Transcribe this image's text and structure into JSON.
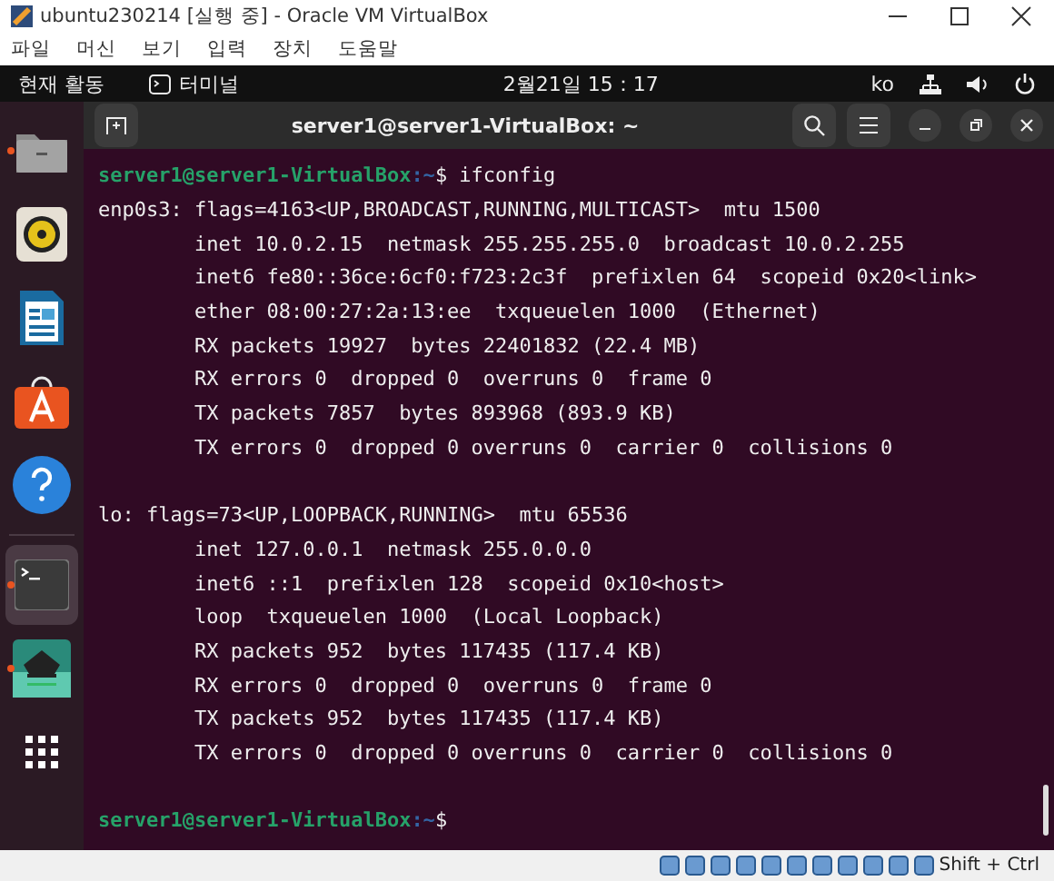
{
  "host_window": {
    "title": "ubuntu230214 [실행 중] - Oracle VM VirtualBox",
    "menu": [
      "파일",
      "머신",
      "보기",
      "입력",
      "장치",
      "도움말"
    ]
  },
  "top_bar": {
    "activities": "현재 활동",
    "app": "터미널",
    "clock": "2월21일  15：17",
    "input_method": "ko"
  },
  "dock": [
    {
      "kind": "files",
      "running": true,
      "selected": false
    },
    {
      "kind": "music",
      "running": false,
      "selected": false
    },
    {
      "kind": "writer",
      "running": false,
      "selected": false
    },
    {
      "kind": "store",
      "running": false,
      "selected": false
    },
    {
      "kind": "help",
      "running": false,
      "selected": false
    },
    {
      "kind": "terminal",
      "running": true,
      "selected": true
    },
    {
      "kind": "app",
      "running": true,
      "selected": false
    },
    {
      "kind": "grid",
      "running": false,
      "selected": false
    }
  ],
  "terminal": {
    "title": "server1@server1-VirtualBox: ~",
    "lines": [
      {
        "kind": "prompt",
        "user": "server1@server1-VirtualBox",
        "path": ":~",
        "sign": "$",
        "command": " ifconfig"
      },
      {
        "kind": "output",
        "text": "enp0s3: flags=4163<UP,BROADCAST,RUNNING,MULTICAST>  mtu 1500"
      },
      {
        "kind": "output",
        "text": "        inet 10.0.2.15  netmask 255.255.255.0  broadcast 10.0.2.255"
      },
      {
        "kind": "output",
        "text": "        inet6 fe80::36ce:6cf0:f723:2c3f  prefixlen 64  scopeid 0x20<link>"
      },
      {
        "kind": "output",
        "text": "        ether 08:00:27:2a:13:ee  txqueuelen 1000  (Ethernet)"
      },
      {
        "kind": "output",
        "text": "        RX packets 19927  bytes 22401832 (22.4 MB)"
      },
      {
        "kind": "output",
        "text": "        RX errors 0  dropped 0  overruns 0  frame 0"
      },
      {
        "kind": "output",
        "text": "        TX packets 7857  bytes 893968 (893.9 KB)"
      },
      {
        "kind": "output",
        "text": "        TX errors 0  dropped 0 overruns 0  carrier 0  collisions 0"
      },
      {
        "kind": "blank"
      },
      {
        "kind": "output",
        "text": "lo: flags=73<UP,LOOPBACK,RUNNING>  mtu 65536"
      },
      {
        "kind": "output",
        "text": "        inet 127.0.0.1  netmask 255.0.0.0"
      },
      {
        "kind": "output",
        "text": "        inet6 ::1  prefixlen 128  scopeid 0x10<host>"
      },
      {
        "kind": "output",
        "text": "        loop  txqueuelen 1000  (Local Loopback)"
      },
      {
        "kind": "output",
        "text": "        RX packets 952  bytes 117435 (117.4 KB)"
      },
      {
        "kind": "output",
        "text": "        RX errors 0  dropped 0  overruns 0  frame 0"
      },
      {
        "kind": "output",
        "text": "        TX packets 952  bytes 117435 (117.4 KB)"
      },
      {
        "kind": "output",
        "text": "        TX errors 0  dropped 0 overruns 0  carrier 0  collisions 0"
      },
      {
        "kind": "blank"
      },
      {
        "kind": "prompt",
        "user": "server1@server1-VirtualBox",
        "path": ":~",
        "sign": "$"
      }
    ]
  },
  "status_bar": {
    "host_key": "Shift + Ctrl"
  }
}
